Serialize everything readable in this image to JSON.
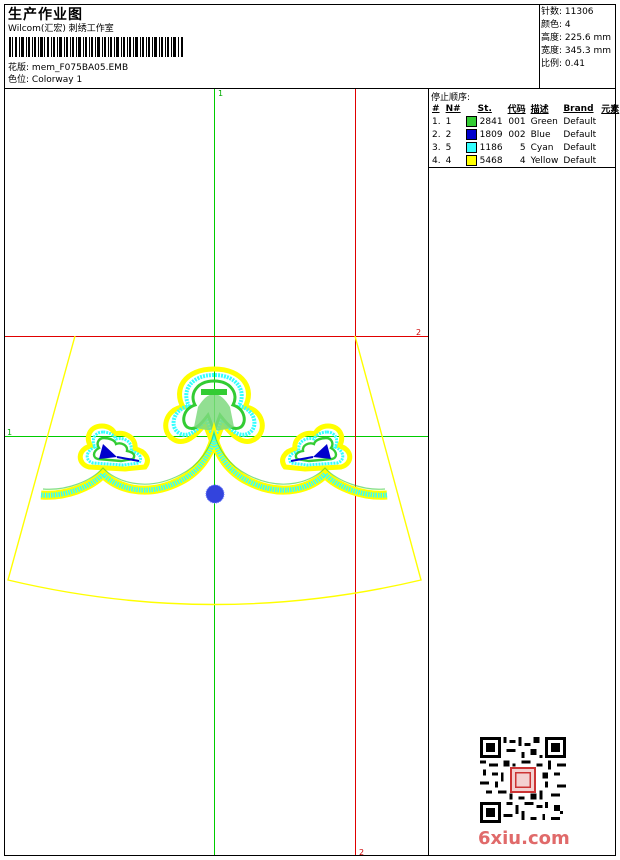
{
  "header": {
    "title": "生产作业图",
    "company": "Wilcom(汇宏) 刺绣工作室",
    "design_label": "花版:",
    "design_value": "mem_F075BA05.EMB",
    "colorway_label": "色位:",
    "colorway_value": "Colorway 1"
  },
  "info": {
    "stitches": "针数: 11306",
    "colors": "颜色: 4",
    "height": "高度: 225.6 mm",
    "width": "宽度: 345.3 mm",
    "scale": "比例: 0.41"
  },
  "stop_sequence": {
    "title": "停止顺序:",
    "headers": [
      "#",
      "N#",
      "St.",
      "代码",
      "描述",
      "Brand",
      "元素"
    ],
    "rows": [
      {
        "index": "1.",
        "n": "1",
        "color": "#33cc33",
        "st": "2841",
        "code": "001",
        "desc": "Green",
        "brand": "Default"
      },
      {
        "index": "2.",
        "n": "2",
        "color": "#0000cc",
        "st": "1809",
        "code": "002",
        "desc": "Blue",
        "brand": "Default"
      },
      {
        "index": "3.",
        "n": "5",
        "color": "#33ffff",
        "st": "1186",
        "code": "5",
        "desc": "Cyan",
        "brand": "Default"
      },
      {
        "index": "4.",
        "n": "4",
        "color": "#ffff00",
        "st": "5468",
        "code": "4",
        "desc": "Yellow",
        "brand": "Default"
      }
    ]
  },
  "canvas": {
    "green_axis_label_top": "1",
    "green_axis_label_left": "1",
    "red_axis_label_right": "2",
    "red_axis_label_bottom": "2"
  },
  "colors": {
    "green": "#33cc33",
    "blue": "#0000cc",
    "cyan": "#33ffff",
    "yellow": "#ffff00",
    "red_guide": "#e00000",
    "green_guide": "#00cc00"
  },
  "watermark": {
    "text": "6xiu.com"
  }
}
